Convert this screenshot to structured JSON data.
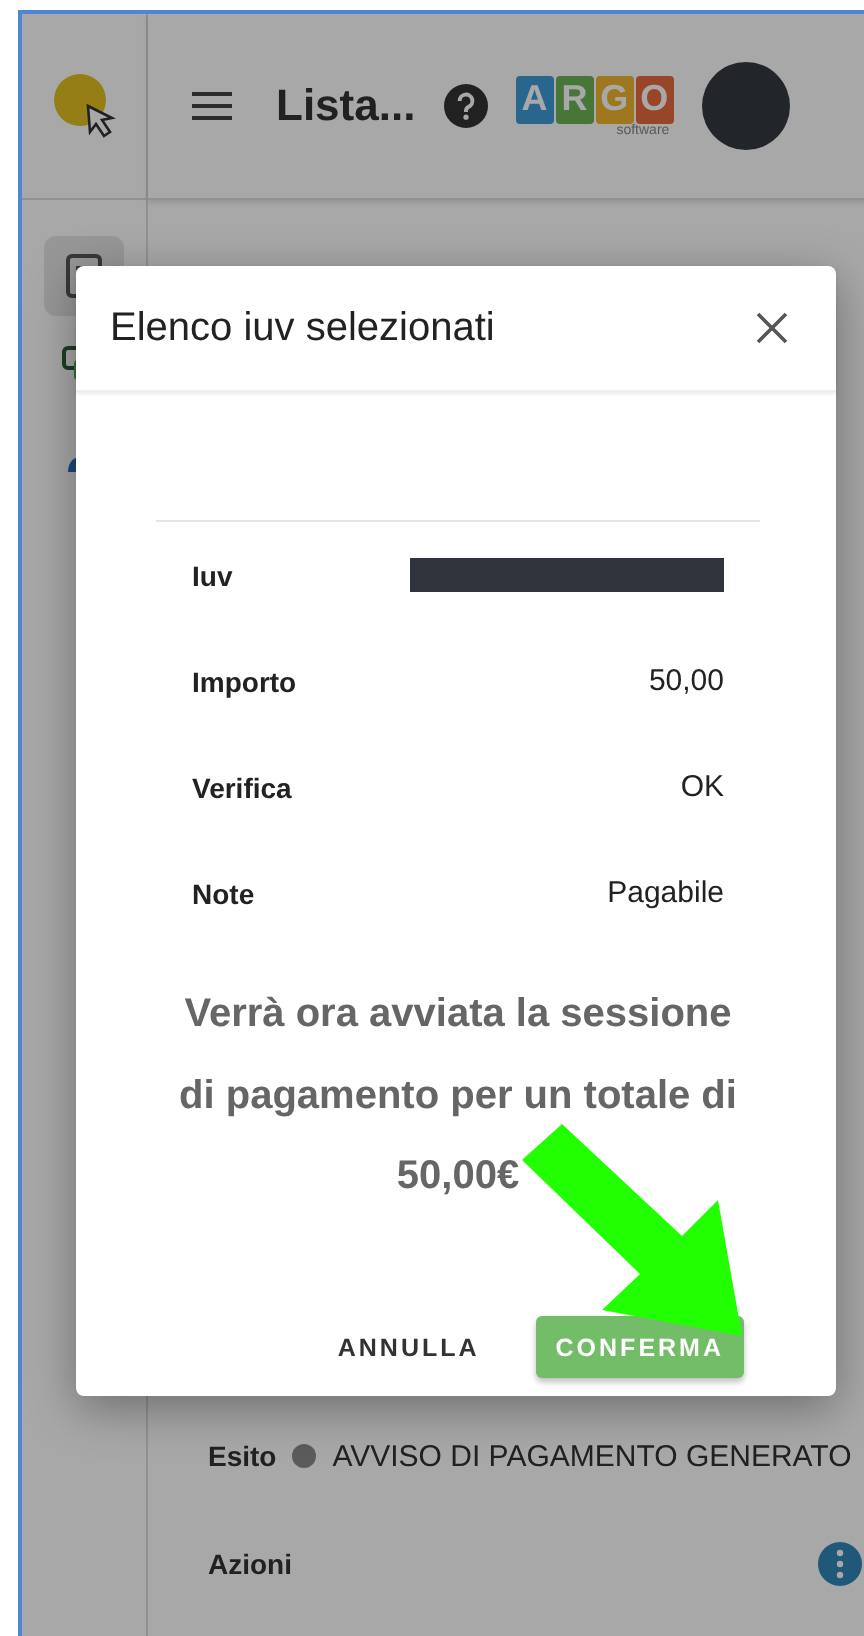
{
  "header": {
    "title": "Lista...",
    "logo": {
      "letters": [
        "A",
        "R",
        "G",
        "O"
      ],
      "tagline": "software"
    }
  },
  "sidebar": {
    "items": [
      {
        "kind": "document",
        "selected": true
      },
      {
        "kind": "payment",
        "selected": false
      },
      {
        "kind": "person",
        "selected": false
      }
    ]
  },
  "outcome": {
    "label": "Esito",
    "value": "AVVISO DI PAGAMENTO GENERATO",
    "color": "#8a8a8a"
  },
  "actions": {
    "label": "Azioni"
  },
  "dialog": {
    "title": "Elenco iuv selezionati",
    "rows": [
      {
        "label": "Iuv",
        "kind": "redacted"
      },
      {
        "label": "Importo",
        "kind": "text",
        "value": "50,00"
      },
      {
        "label": "Verifica",
        "kind": "text",
        "value": "OK"
      },
      {
        "label": "Note",
        "kind": "text",
        "value": "Pagabile"
      }
    ],
    "message_lines": [
      "Verrà ora avviata la sessione",
      "di pagamento per un totale di",
      "50,00€"
    ],
    "buttons": [
      {
        "label": "ANNULLA",
        "kind": "text"
      },
      {
        "label": "CONFERMA",
        "kind": "primary"
      }
    ]
  }
}
